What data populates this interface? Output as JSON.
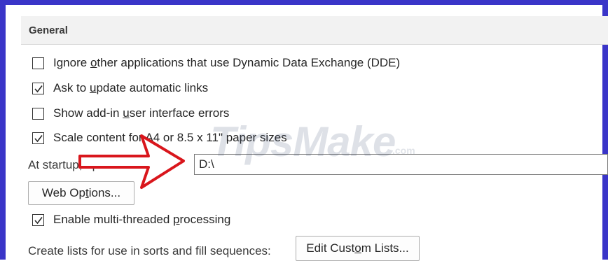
{
  "section": {
    "title": "General"
  },
  "options": {
    "ignore_dde": {
      "checked": false,
      "pre": "Ignore ",
      "key": "o",
      "post": "ther applications that use Dynamic Data Exchange (DDE)"
    },
    "ask_update_links": {
      "checked": true,
      "pre": "Ask to ",
      "key": "u",
      "post": "pdate automatic links"
    },
    "show_addin_errors": {
      "checked": false,
      "pre": "Show add-in ",
      "key": "u",
      "post": "ser interface errors"
    },
    "scale_content": {
      "checked": true,
      "pre": "Scale content for ",
      "key": "A",
      "post": "4 or 8.5 x 11\" paper sizes"
    },
    "multithread": {
      "checked": true,
      "pre": "Enable multi-threaded ",
      "key": "p",
      "post": "rocessing"
    }
  },
  "startup": {
    "label": "At startup, open all files in:",
    "value": "D:\\"
  },
  "web_options": {
    "pre": "Web Op",
    "key": "t",
    "post": "ions..."
  },
  "custom_lists": {
    "label": "Create lists for use in sorts and fill sequences:",
    "button_pre": "Edit Cust",
    "button_key": "o",
    "button_post": "m Lists..."
  },
  "watermark": {
    "brand": "TipsMake",
    "suffix": ".com"
  },
  "colors": {
    "frame": "#3a35c8",
    "arrow": "#d9161c",
    "header_bg": "#f2f2f2"
  }
}
